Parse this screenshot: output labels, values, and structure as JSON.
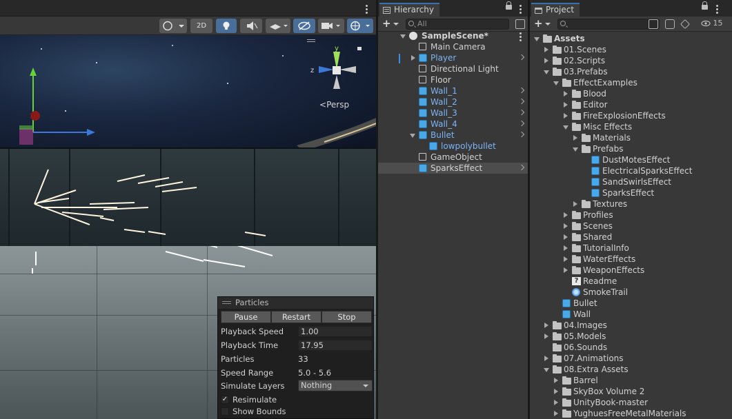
{
  "scene": {
    "toolbar": {
      "mode_2d_label": "2D",
      "persp_label": "Persp",
      "gizmo_axis_x": "x",
      "gizmo_axis_y": "y",
      "gizmo_axis_z": "z"
    },
    "particles_panel": {
      "title": "Particles",
      "buttons": [
        "Pause",
        "Restart",
        "Stop"
      ],
      "playback_speed_label": "Playback Speed",
      "playback_speed_value": "1.00",
      "playback_time_label": "Playback Time",
      "playback_time_value": "17.95",
      "particles_label": "Particles",
      "particles_value": "33",
      "speed_range_label": "Speed Range",
      "speed_range_value": "5.0 - 5.6",
      "simulate_layers_label": "Simulate Layers",
      "simulate_layers_value": "Nothing",
      "resimulate_label": "Resimulate",
      "resimulate_checked": true,
      "show_bounds_label": "Show Bounds",
      "show_bounds_checked": false
    }
  },
  "hierarchy": {
    "tab_label": "Hierarchy",
    "search_placeholder": "All",
    "scene_name": "SampleScene*",
    "items": [
      {
        "label": "Main Camera",
        "icon": "gameobject-icon",
        "prefab": false
      },
      {
        "label": "Player",
        "icon": "prefab-icon",
        "prefab": true,
        "expandable": true
      },
      {
        "label": "Directional Light",
        "icon": "gameobject-icon",
        "prefab": false
      },
      {
        "label": "Floor",
        "icon": "gameobject-icon",
        "prefab": false
      },
      {
        "label": "Wall_1",
        "icon": "prefab-icon",
        "prefab": true
      },
      {
        "label": "Wall_2",
        "icon": "prefab-icon",
        "prefab": true
      },
      {
        "label": "Wall_3",
        "icon": "prefab-icon",
        "prefab": true
      },
      {
        "label": "Wall_4",
        "icon": "prefab-icon",
        "prefab": true
      },
      {
        "label": "Bullet",
        "icon": "prefab-icon",
        "prefab": true,
        "expanded": true
      },
      {
        "label": "lowpolybullet",
        "icon": "prefab-icon",
        "prefab": true,
        "child": true
      },
      {
        "label": "GameObject",
        "icon": "gameobject-icon",
        "prefab": false
      },
      {
        "label": "SparksEffect",
        "icon": "prefab-icon",
        "prefab": false,
        "selected": true
      }
    ]
  },
  "project": {
    "tab_label": "Project",
    "visible_count": "15",
    "tree": [
      {
        "label": "Assets",
        "depth": 0,
        "state": "down",
        "icon": "folder",
        "bold": true
      },
      {
        "label": "01.Scenes",
        "depth": 1,
        "state": "right",
        "icon": "folder"
      },
      {
        "label": "02.Scripts",
        "depth": 1,
        "state": "right",
        "icon": "folder"
      },
      {
        "label": "03.Prefabs",
        "depth": 1,
        "state": "down",
        "icon": "folder"
      },
      {
        "label": "EffectExamples",
        "depth": 2,
        "state": "down",
        "icon": "folder"
      },
      {
        "label": "Blood",
        "depth": 3,
        "state": "right",
        "icon": "folder"
      },
      {
        "label": "Editor",
        "depth": 3,
        "state": "right",
        "icon": "folder"
      },
      {
        "label": "FireExplosionEffects",
        "depth": 3,
        "state": "right",
        "icon": "folder"
      },
      {
        "label": "Misc Effects",
        "depth": 3,
        "state": "down",
        "icon": "folder"
      },
      {
        "label": "Materials",
        "depth": 4,
        "state": "right",
        "icon": "folder"
      },
      {
        "label": "Prefabs",
        "depth": 4,
        "state": "down",
        "icon": "folder"
      },
      {
        "label": "DustMotesEffect",
        "depth": 5,
        "state": "none",
        "icon": "prefab"
      },
      {
        "label": "ElectricalSparksEffect",
        "depth": 5,
        "state": "none",
        "icon": "prefab"
      },
      {
        "label": "SandSwirlsEffect",
        "depth": 5,
        "state": "none",
        "icon": "prefab"
      },
      {
        "label": "SparksEffect",
        "depth": 5,
        "state": "none",
        "icon": "prefab"
      },
      {
        "label": "Textures",
        "depth": 4,
        "state": "right",
        "icon": "folder"
      },
      {
        "label": "Profiles",
        "depth": 3,
        "state": "right",
        "icon": "folder"
      },
      {
        "label": "Scenes",
        "depth": 3,
        "state": "right",
        "icon": "folder"
      },
      {
        "label": "Shared",
        "depth": 3,
        "state": "right",
        "icon": "folder"
      },
      {
        "label": "TutorialInfo",
        "depth": 3,
        "state": "right",
        "icon": "folder"
      },
      {
        "label": "WaterEffects",
        "depth": 3,
        "state": "right",
        "icon": "folder"
      },
      {
        "label": "WeaponEffects",
        "depth": 3,
        "state": "right",
        "icon": "folder"
      },
      {
        "label": "Readme",
        "depth": 3,
        "state": "none",
        "icon": "readme"
      },
      {
        "label": "SmokeTrail",
        "depth": 3,
        "state": "none",
        "icon": "smoke"
      },
      {
        "label": "Bullet",
        "depth": 2,
        "state": "none",
        "icon": "prefab"
      },
      {
        "label": "Wall",
        "depth": 2,
        "state": "none",
        "icon": "prefab"
      },
      {
        "label": "04.Images",
        "depth": 1,
        "state": "right",
        "icon": "folder"
      },
      {
        "label": "05.Models",
        "depth": 1,
        "state": "right",
        "icon": "folder"
      },
      {
        "label": "06.Sounds",
        "depth": 1,
        "state": "none",
        "icon": "folder"
      },
      {
        "label": "07.Animations",
        "depth": 1,
        "state": "right",
        "icon": "folder"
      },
      {
        "label": "08.Extra Assets",
        "depth": 1,
        "state": "down",
        "icon": "folder"
      },
      {
        "label": "Barrel",
        "depth": 2,
        "state": "right",
        "icon": "folder"
      },
      {
        "label": "SkyBox Volume 2",
        "depth": 2,
        "state": "right",
        "icon": "folder"
      },
      {
        "label": "UnityBook-master",
        "depth": 2,
        "state": "right",
        "icon": "folder"
      },
      {
        "label": "YughuesFreeMetalMaterials",
        "depth": 2,
        "state": "right",
        "icon": "folder"
      }
    ]
  }
}
